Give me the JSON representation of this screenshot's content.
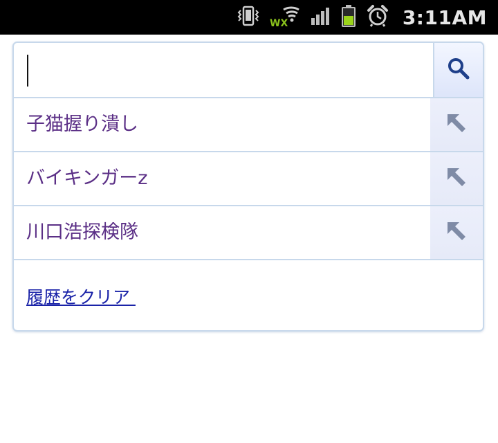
{
  "status_bar": {
    "time": "3:11AM",
    "icons": [
      "vibrate-icon",
      "wifi-icon",
      "signal-icon",
      "battery-icon",
      "alarm-icon"
    ],
    "wifi_label": "WX",
    "colors": {
      "background": "#000000",
      "wifi_accent": "#8ac11c",
      "battery_fill": "#9bd41b"
    }
  },
  "search": {
    "value": "",
    "placeholder": "",
    "button_icon": "search-icon"
  },
  "suggestions": [
    {
      "text": "子猫握り潰し",
      "action_icon": "refine-arrow-icon"
    },
    {
      "text": "バイキンガーz",
      "action_icon": "refine-arrow-icon"
    },
    {
      "text": "川口浩探検隊",
      "action_icon": "refine-arrow-icon"
    }
  ],
  "clear_history_label": "履歴をクリア ",
  "colors": {
    "suggestion_text": "#5b2f86",
    "link": "#1a23a8",
    "panel_border": "#c7d8eb"
  }
}
